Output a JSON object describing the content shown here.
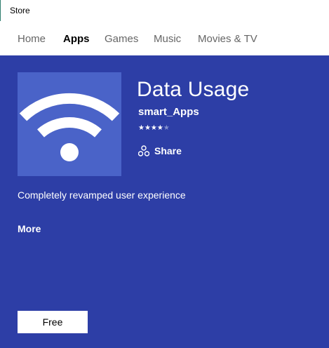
{
  "window": {
    "title": "Store"
  },
  "nav": {
    "tabs": [
      {
        "label": "Home",
        "active": false
      },
      {
        "label": "Apps",
        "active": true
      },
      {
        "label": "Games",
        "active": false
      },
      {
        "label": "Music",
        "active": false
      },
      {
        "label": "Movies & TV",
        "active": false
      }
    ]
  },
  "app": {
    "icon": "wifi-icon",
    "name": "Data Usage",
    "publisher": "smart_Apps",
    "rating": {
      "value": 4,
      "max": 5,
      "stars_text": "★★★★",
      "empty_stars_text": "★"
    },
    "share_label": "Share",
    "share_icon": "share-icon",
    "description": "Completely revamped user experience",
    "more_label": "More",
    "price_label": "Free"
  },
  "colors": {
    "hero_background": "#2d3ea6",
    "tile_background": "#4a63c8",
    "active_tab": "#000000",
    "inactive_tab": "#666666"
  }
}
